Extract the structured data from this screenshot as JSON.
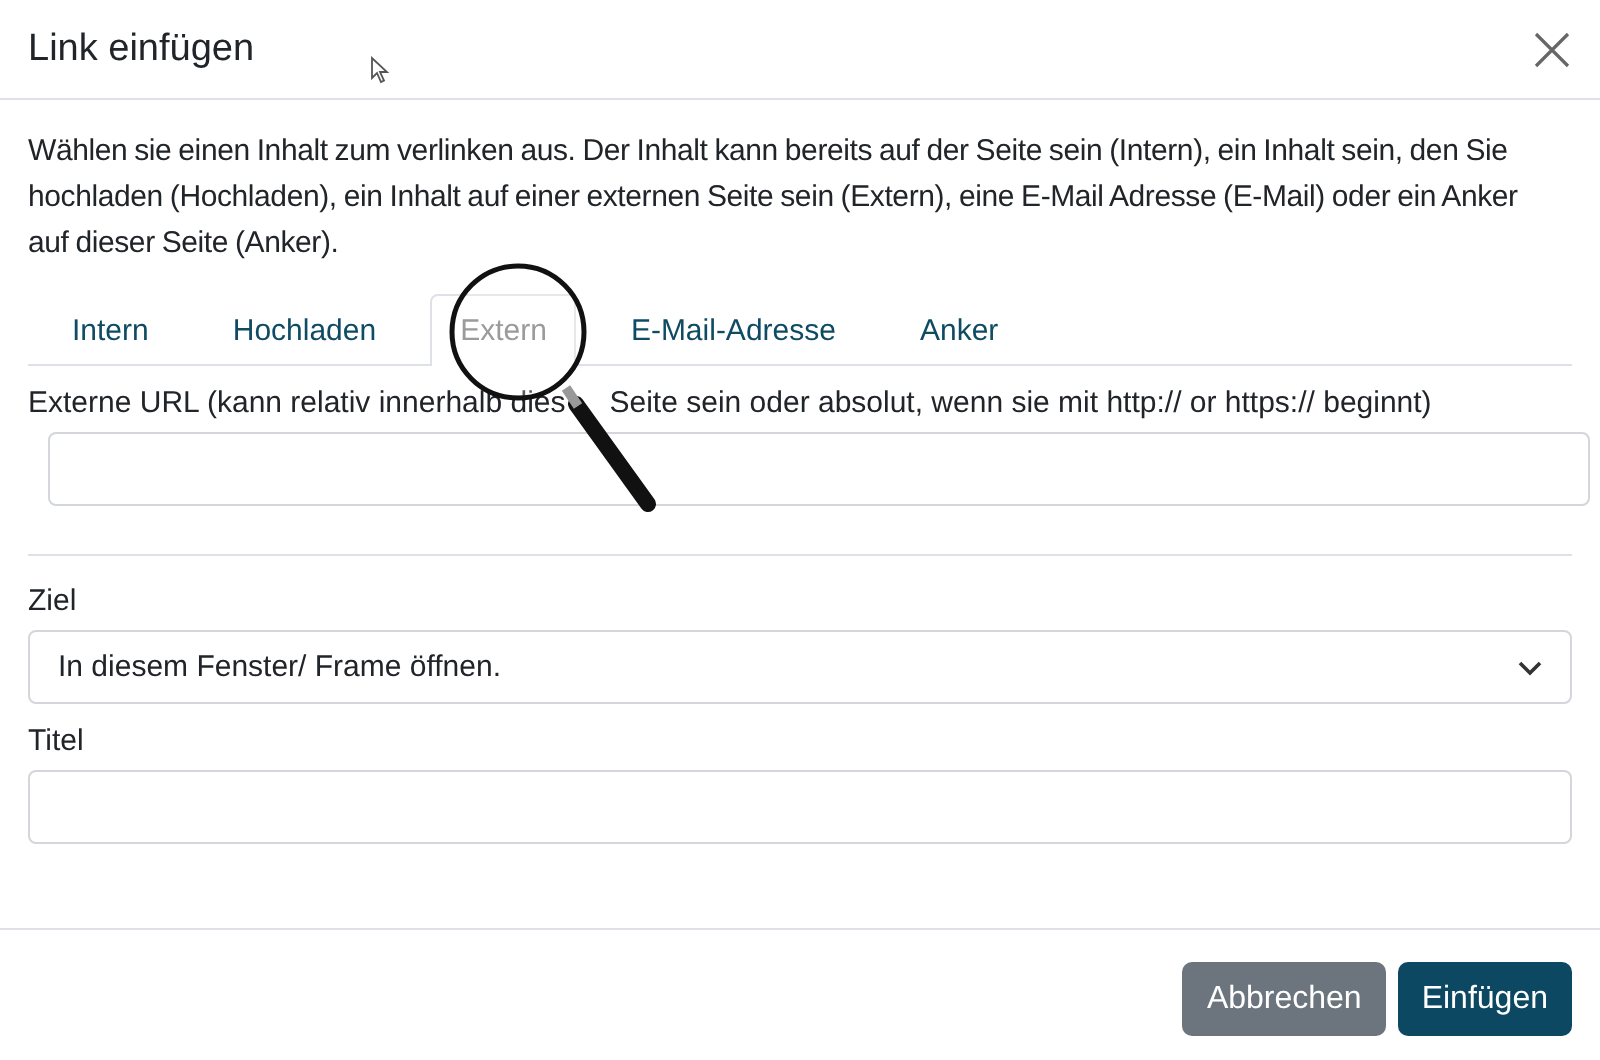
{
  "dialog": {
    "title": "Link einfügen",
    "description": "Wählen sie einen Inhalt zum verlinken aus. Der Inhalt kann bereits auf der Seite sein (Intern), ein Inhalt sein, den Sie hochladen (Hochladen), ein Inhalt auf einer externen Seite sein (Extern), eine E-Mail Adresse (E-Mail) oder ein Anker auf dieser Seite (Anker)."
  },
  "tabs": [
    {
      "label": "Intern",
      "selected": false
    },
    {
      "label": "Hochladen",
      "selected": false
    },
    {
      "label": "Extern",
      "selected": true
    },
    {
      "label": "E-Mail-Adresse",
      "selected": false
    },
    {
      "label": "Anker",
      "selected": false
    }
  ],
  "url_field": {
    "label_parts": [
      "Externe URL (kann relativ innerhalb dies",
      "Seite sein oder absolut, wenn sie mit http:// or https:// beginnt)"
    ]
  },
  "target": {
    "label": "Ziel",
    "value": "In diesem Fenster/ Frame öffnen."
  },
  "title_field": {
    "label": "Titel"
  },
  "buttons": [
    {
      "label": "Abbrechen",
      "kind": "secondary"
    },
    {
      "label": "Einfügen",
      "kind": "primary"
    }
  ]
}
